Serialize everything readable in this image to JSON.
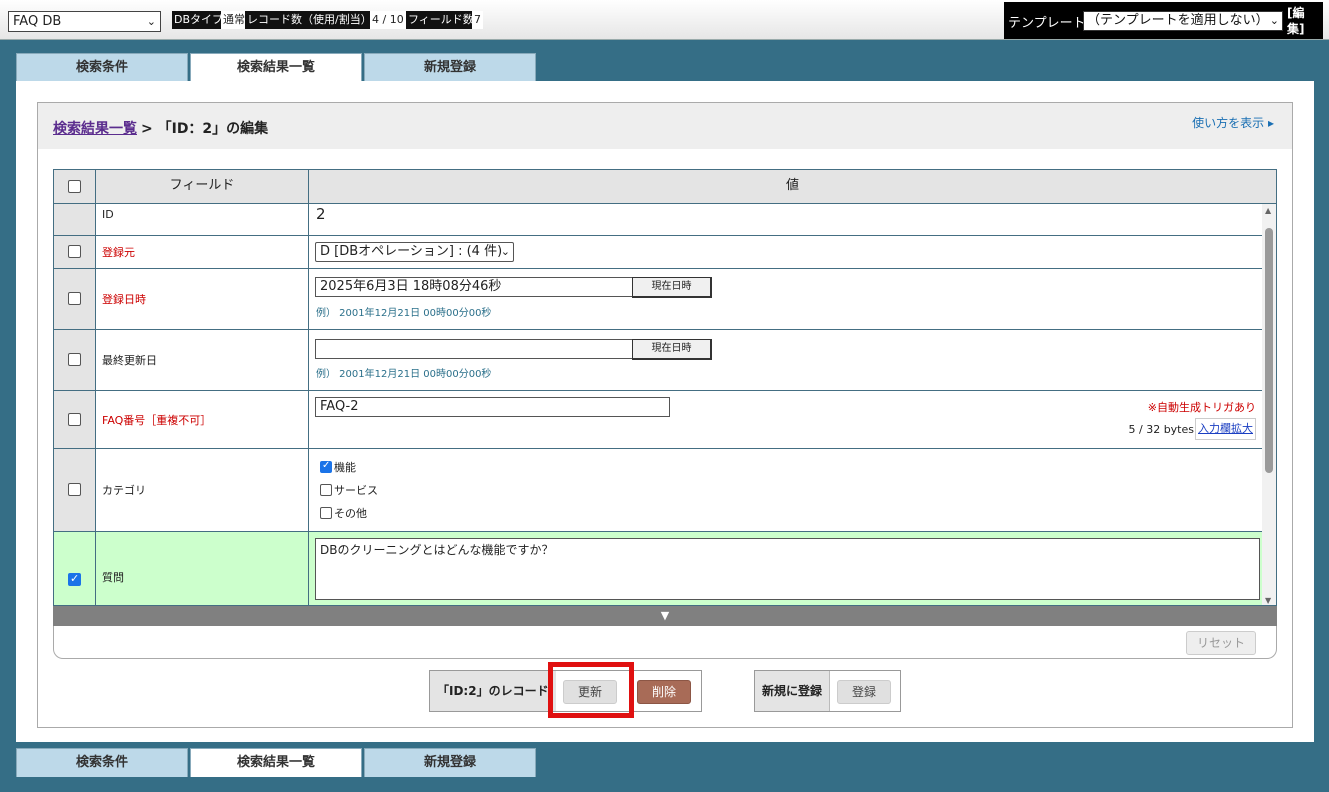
{
  "topbar": {
    "db_select": "FAQ DB",
    "db_type_label": "DBタイプ",
    "db_type_value": "通常",
    "record_count_label": "レコード数（使用/割当）",
    "record_count_value": "4 / 10",
    "field_count_label": "フィールド数",
    "field_count_value": "7",
    "template_label": "テンプレート",
    "template_select": "（テンプレートを適用しない）",
    "template_edit": "[編集]"
  },
  "tabs": [
    "検索条件",
    "検索結果一覧",
    "新規登録"
  ],
  "breadcrumb": {
    "link": "検索結果一覧",
    "rest": "> 「ID：2」の編集"
  },
  "howto": "使い方を表示 ▸",
  "grid": {
    "header_field": "フィールド",
    "header_value": "値",
    "rows": {
      "id": {
        "label": "ID",
        "value": "2"
      },
      "source": {
        "label": "登録元",
        "value": "D [DBオペレーション] : (4 件)"
      },
      "regdate": {
        "label": "登録日時",
        "value": "2025年6月3日 18時08分46秒",
        "button": "現在日時",
        "example": "例） 2001年12月21日 00時00分00秒"
      },
      "updated": {
        "label": "最終更新日",
        "value": "",
        "button": "現在日時",
        "example": "例） 2001年12月21日 00時00分00秒"
      },
      "faqno": {
        "label": "FAQ番号［重複不可］",
        "value": "FAQ-2",
        "trigger_note": "※自動生成トリガあり",
        "bytes": "5 / 32 bytes",
        "expand_link": "入力欄拡大"
      },
      "category": {
        "label": "カテゴリ",
        "options": [
          {
            "label": "機能",
            "checked": true
          },
          {
            "label": "サービス",
            "checked": false
          },
          {
            "label": "その他",
            "checked": false
          }
        ]
      },
      "question": {
        "label": "質問",
        "value": "DBのクリーニングとはどんな機能ですか？"
      }
    },
    "expand_arrow": "▼",
    "reset": "リセット"
  },
  "actions": {
    "record_label": "「ID:2」のレコード",
    "update": "更新",
    "delete": "削除",
    "new_label": "新規に登録",
    "register": "登録"
  }
}
